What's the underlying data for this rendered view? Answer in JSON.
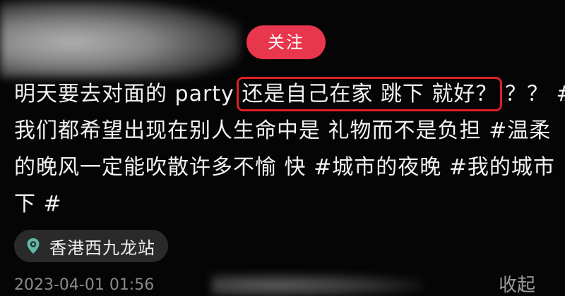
{
  "header": {
    "follow_label": "关注"
  },
  "post": {
    "line1_before": "明天要去对面的 party ",
    "line1_highlight": "还是自己在家 跳下 就好？",
    "line1_after": " ？？ #",
    "line2": "我们都希望出现在别人生命中是 礼物而不是负担 #温柔",
    "line3": "的晚风一定能吹散许多不愉 快 #城市的夜晚  #我的城市",
    "line4": "下 #"
  },
  "location": {
    "icon": "location-pin-icon",
    "label": "香港西九龙站"
  },
  "meta": {
    "timestamp": "2023-04-01 01:56",
    "collapse_label": "收起"
  },
  "colors": {
    "follow_button": "#e8364d",
    "highlight_outline": "#e01f26",
    "location_pin": "#5fb9a8"
  }
}
